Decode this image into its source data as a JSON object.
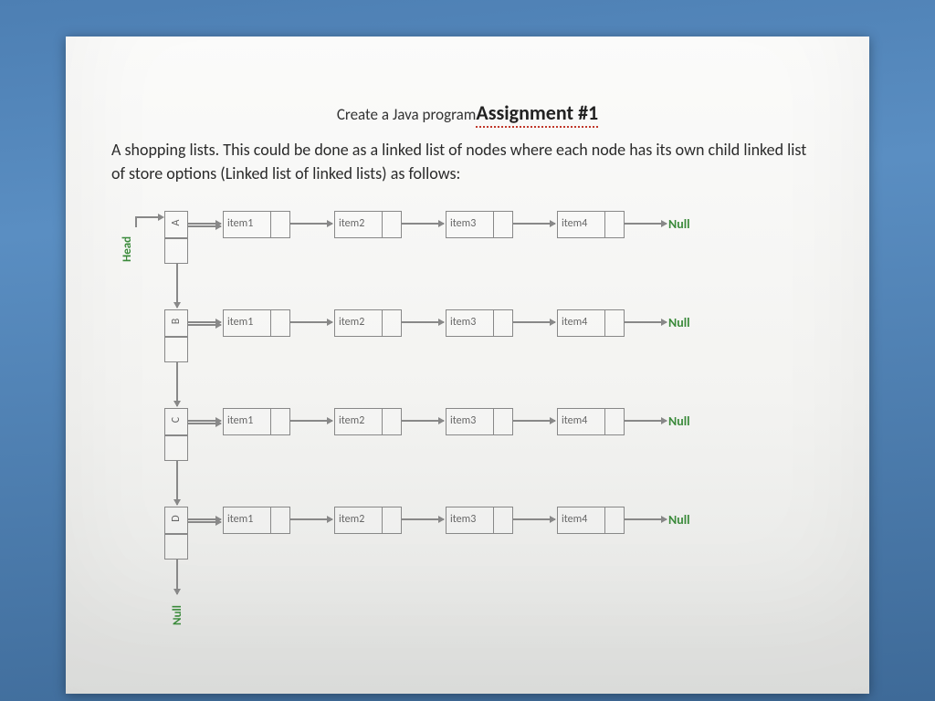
{
  "title": {
    "prefix": "Create a Java program",
    "main": "Assignment #1"
  },
  "description": "A shopping lists. This could be done as a linked list of nodes where each node has its own child linked list of store options (Linked list of linked lists) as follows:",
  "diagram": {
    "head_label": "Head",
    "vertical_null": "Null",
    "vnodes": [
      "A",
      "B",
      "C",
      "D"
    ],
    "rows": [
      {
        "items": [
          "item1",
          "item2",
          "item3",
          "item4"
        ],
        "end": "Null"
      },
      {
        "items": [
          "item1",
          "item2",
          "item3",
          "item4"
        ],
        "end": "Null"
      },
      {
        "items": [
          "item1",
          "item2",
          "item3",
          "item4"
        ],
        "end": "Null"
      },
      {
        "items": [
          "item1",
          "item2",
          "item3",
          "item4"
        ],
        "end": "Null"
      }
    ]
  }
}
